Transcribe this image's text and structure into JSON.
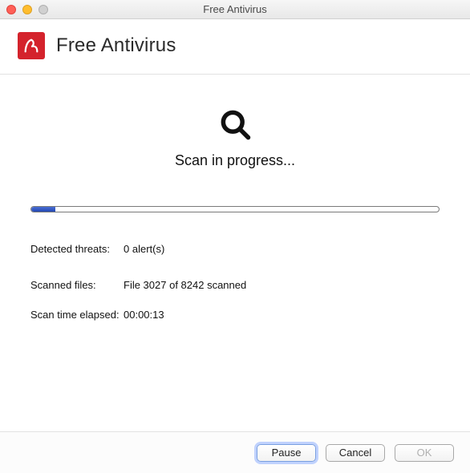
{
  "window": {
    "title": "Free Antivirus"
  },
  "header": {
    "app_name": "Free Antivirus"
  },
  "scan": {
    "status_text": "Scan in progress...",
    "progress_percent": 6
  },
  "stats": {
    "threats_label": "Detected threats:",
    "threats_value": "0 alert(s)",
    "files_label": "Scanned files:",
    "files_value": "File 3027 of 8242 scanned",
    "time_label": "Scan time elapsed:",
    "time_value": "00:00:13"
  },
  "buttons": {
    "pause": "Pause",
    "cancel": "Cancel",
    "ok": "OK"
  },
  "colors": {
    "brand": "#d4232c",
    "progress": "#2247b3"
  }
}
